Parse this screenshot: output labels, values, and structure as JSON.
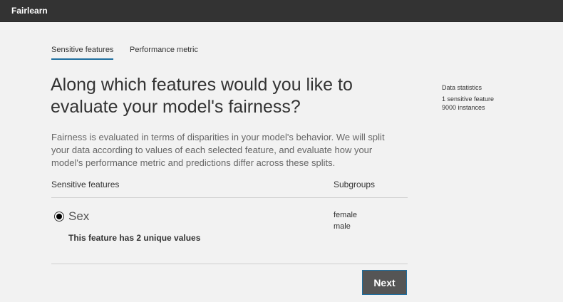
{
  "app": {
    "title": "Fairlearn"
  },
  "tabs": [
    {
      "label": "Sensitive features",
      "active": true
    },
    {
      "label": "Performance metric",
      "active": false
    }
  ],
  "main": {
    "heading": "Along which features would you like to evaluate your model's fairness?",
    "description": "Fairness is evaluated in terms of disparities in your model's behavior. We will split your data according to values of each selected feature, and evaluate how your model's performance metric and predictions differ across these splits.",
    "columns": {
      "features": "Sensitive features",
      "subgroups": "Subgroups"
    },
    "feature": {
      "label": "Sex",
      "selected": true,
      "summary": "This feature has 2 unique values",
      "subgroups": [
        "female",
        "male"
      ]
    },
    "next_label": "Next"
  },
  "stats": {
    "title": "Data statistics",
    "lines": [
      "1 sensitive feature",
      "9000 instances"
    ]
  },
  "colors": {
    "topbar": "#333333",
    "accent": "#1f6f9f",
    "button": "#555555"
  }
}
